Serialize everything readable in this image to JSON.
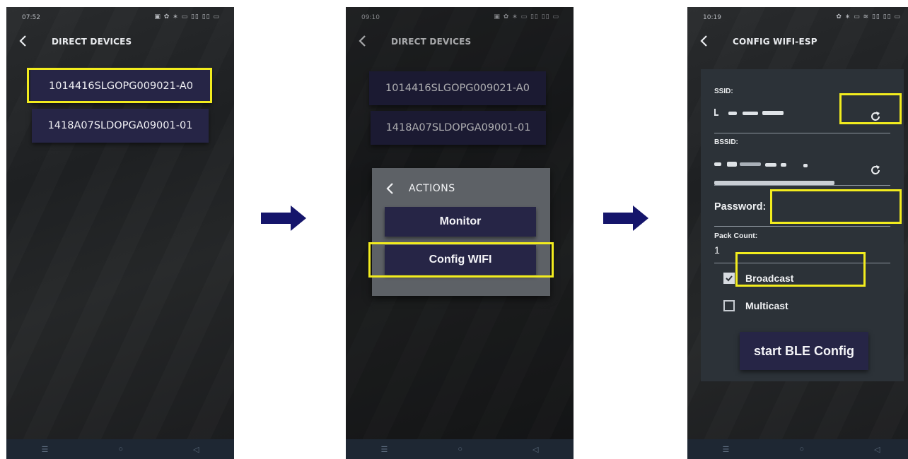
{
  "colors": {
    "highlight": "#f2ec1e",
    "button": "#262546",
    "arrow": "#15156b"
  },
  "screen1": {
    "time": "07:52",
    "status_icons": "▣ ✿ ∗ ▭ ▯▯ ▯▯ ▭",
    "title": "DIRECT DEVICES",
    "devices": [
      "1014416SLGOPG009021-A0",
      "1418A07SLDOPGA09001-01"
    ],
    "nav": [
      "☰",
      "○",
      "◁"
    ]
  },
  "screen2": {
    "time": "09:10",
    "status_icons": "▣ ✿ ∗ ▭ ▯▯ ▯▯ ▭",
    "title": "DIRECT DEVICES",
    "devices": [
      "1014416SLGOPG009021-A0",
      "1418A07SLDOPGA09001-01"
    ],
    "dialog": {
      "title": "ACTIONS",
      "buttons": [
        "Monitor",
        "Config WIFI"
      ]
    },
    "nav": [
      "☰",
      "○",
      "◁"
    ]
  },
  "screen3": {
    "time": "10:19",
    "status_icons": "✿ ∗ ▭ ≋ ▯▯ ▯▯ ▭",
    "title": "CONFIG WIFI-ESP",
    "ssid_label": "SSID:",
    "bssid_label": "BSSID:",
    "password_label": "Password:",
    "pack_count_label": "Pack Count:",
    "pack_count_value": "1",
    "broadcast_label": "Broadcast",
    "broadcast_checked": true,
    "multicast_label": "Multicast",
    "multicast_checked": false,
    "start_button": "start BLE Config",
    "nav": [
      "☰",
      "○",
      "◁"
    ]
  }
}
